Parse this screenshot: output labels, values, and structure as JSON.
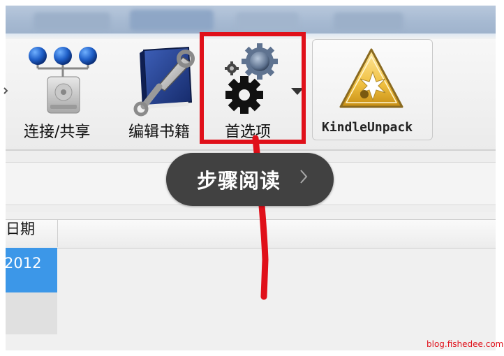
{
  "toolbar": {
    "connect_share": "连接/共享",
    "edit_book": "编辑书籍",
    "preferences": "首选项",
    "kindle_unpack": "KindleUnpack"
  },
  "tooltip": {
    "label": "步骤阅读"
  },
  "table": {
    "column_header": "日期",
    "selected_cell": "2012"
  },
  "watermark": "blog.fishedee.com",
  "colors": {
    "highlight": "#e0101a",
    "selection": "#3c97e8",
    "tooltip_bg": "#414141"
  },
  "icons": [
    "connect-share-icon",
    "edit-book-icon",
    "preferences-gear-icon",
    "kindle-unpack-warning-icon",
    "dropdown-caret-icon",
    "chevron-right-icon"
  ]
}
